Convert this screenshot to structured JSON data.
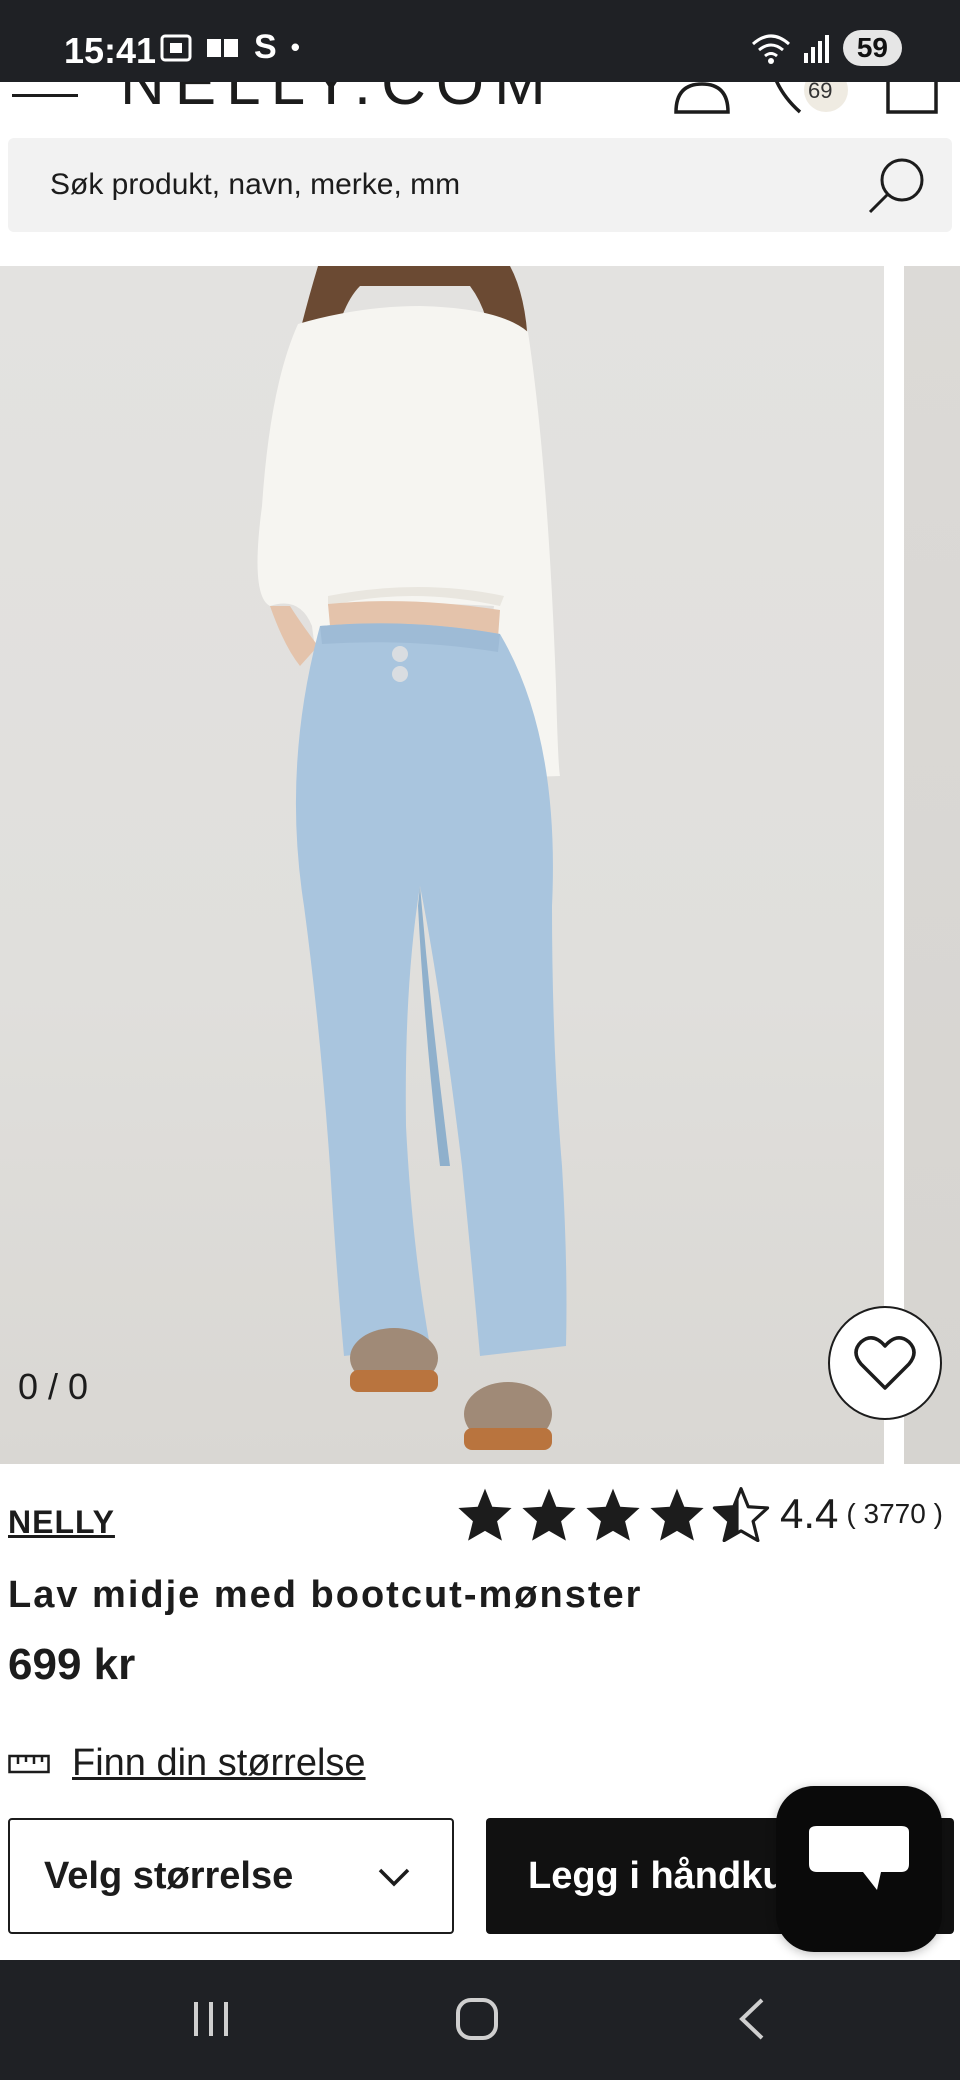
{
  "status_bar": {
    "time": "15:41",
    "carrier_glyph": "S",
    "dot": "•",
    "battery": "59"
  },
  "header": {
    "logo": "NELLY.COM",
    "wishlist_count": "69"
  },
  "search": {
    "placeholder": "Søk produkt, navn, merke, mm"
  },
  "gallery": {
    "counter": "0 / 0"
  },
  "product": {
    "brand": "NELLY",
    "rating_value": "4.4",
    "rating_count": "( 3770 )",
    "rating_stars": 4.4,
    "title": "Lav midje med bootcut-mønster",
    "price": "699 kr"
  },
  "size_guide": {
    "label": "Finn din størrelse"
  },
  "actions": {
    "size_select_label": "Velg størrelse",
    "add_to_cart_label": "Legg i håndkurv"
  },
  "icons": {
    "search": "search-icon",
    "heart": "heart-icon",
    "ruler": "ruler-icon",
    "chevron": "chevron-down-icon",
    "chat": "chat-icon"
  },
  "colors": {
    "primary": "#111111",
    "system_bar": "#1f2125",
    "search_bg": "#f2f2f2"
  }
}
